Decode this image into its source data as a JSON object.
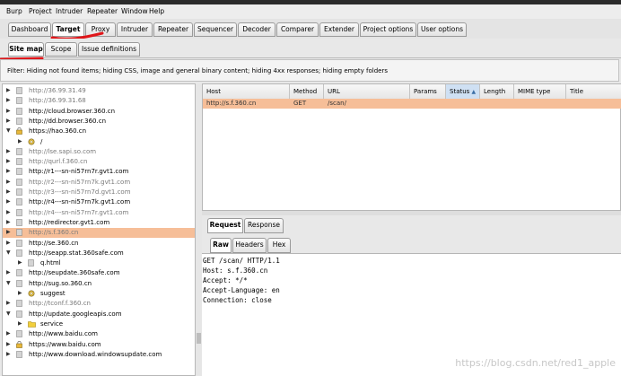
{
  "menu": [
    "Burp",
    "Project",
    "Intruder",
    "Repeater",
    "Window",
    "Help"
  ],
  "main_tabs": [
    "Dashboard",
    "Target",
    "Proxy",
    "Intruder",
    "Repeater",
    "Sequencer",
    "Decoder",
    "Comparer",
    "Extender",
    "Project options",
    "User options"
  ],
  "sub_tabs": [
    "Site map",
    "Scope",
    "Issue definitions"
  ],
  "filter_text": "Filter: Hiding not found items;  hiding CSS, image and general binary content;  hiding 4xx responses;  hiding empty folders",
  "tree": [
    {
      "label": "http://36.99.31.49",
      "bold": false,
      "expanded": false,
      "level": 0,
      "icon": "page-icon"
    },
    {
      "label": "http://36.99.31.68",
      "bold": false,
      "expanded": false,
      "level": 0,
      "icon": "page-icon"
    },
    {
      "label": "http://cloud.browser.360.cn",
      "bold": true,
      "expanded": false,
      "level": 0,
      "icon": "page-icon"
    },
    {
      "label": "http://dd.browser.360.cn",
      "bold": true,
      "expanded": false,
      "level": 0,
      "icon": "page-icon"
    },
    {
      "label": "https://hao.360.cn",
      "bold": true,
      "expanded": true,
      "level": 0,
      "icon": "lock-icon"
    },
    {
      "label": "/",
      "bold": true,
      "expanded": false,
      "level": 1,
      "icon": "gear-icon"
    },
    {
      "label": "http://lse.sapi.so.com",
      "bold": false,
      "expanded": false,
      "level": 0,
      "icon": "page-icon"
    },
    {
      "label": "http://qurl.f.360.cn",
      "bold": false,
      "expanded": false,
      "level": 0,
      "icon": "page-icon"
    },
    {
      "label": "http://r1---sn-ni57rn7r.gvt1.com",
      "bold": true,
      "expanded": false,
      "level": 0,
      "icon": "page-icon"
    },
    {
      "label": "http://r2---sn-ni57rn7k.gvt1.com",
      "bold": false,
      "expanded": false,
      "level": 0,
      "icon": "page-icon"
    },
    {
      "label": "http://r3---sn-ni57rn7d.gvt1.com",
      "bold": false,
      "expanded": false,
      "level": 0,
      "icon": "page-icon"
    },
    {
      "label": "http://r4---sn-ni57rn7k.gvt1.com",
      "bold": true,
      "expanded": false,
      "level": 0,
      "icon": "page-icon"
    },
    {
      "label": "http://r4---sn-ni57rn7r.gvt1.com",
      "bold": false,
      "expanded": false,
      "level": 0,
      "icon": "page-icon"
    },
    {
      "label": "http://redirector.gvt1.com",
      "bold": true,
      "expanded": false,
      "level": 0,
      "icon": "page-icon"
    },
    {
      "label": "http://s.f.360.cn",
      "bold": false,
      "expanded": false,
      "level": 0,
      "icon": "page-icon",
      "selected": true
    },
    {
      "label": "http://se.360.cn",
      "bold": true,
      "expanded": false,
      "level": 0,
      "icon": "page-icon"
    },
    {
      "label": "http://seapp.stat.360safe.com",
      "bold": true,
      "expanded": true,
      "level": 0,
      "icon": "page-icon"
    },
    {
      "label": "q.html",
      "bold": true,
      "expanded": false,
      "level": 1,
      "icon": "page-icon"
    },
    {
      "label": "http://seupdate.360safe.com",
      "bold": true,
      "expanded": false,
      "level": 0,
      "icon": "page-icon"
    },
    {
      "label": "http://sug.so.360.cn",
      "bold": true,
      "expanded": true,
      "level": 0,
      "icon": "page-icon"
    },
    {
      "label": "suggest",
      "bold": true,
      "expanded": false,
      "level": 1,
      "icon": "gear-icon"
    },
    {
      "label": "http://tconf.f.360.cn",
      "bold": false,
      "expanded": false,
      "level": 0,
      "icon": "page-icon"
    },
    {
      "label": "http://update.googleapis.com",
      "bold": true,
      "expanded": true,
      "level": 0,
      "icon": "page-icon"
    },
    {
      "label": "service",
      "bold": true,
      "expanded": false,
      "level": 1,
      "icon": "folder-icon"
    },
    {
      "label": "http://www.baidu.com",
      "bold": true,
      "expanded": false,
      "level": 0,
      "icon": "page-icon"
    },
    {
      "label": "https://www.baidu.com",
      "bold": true,
      "expanded": false,
      "level": 0,
      "icon": "lock-icon"
    },
    {
      "label": "http://www.download.windowsupdate.com",
      "bold": true,
      "expanded": false,
      "level": 0,
      "icon": "page-icon"
    }
  ],
  "table": {
    "columns": [
      "Host",
      "Method",
      "URL",
      "Params",
      "Status",
      "Length",
      "MIME type",
      "Title"
    ],
    "sorted_column": "Status",
    "sort_glyph": "▲",
    "rows": [
      {
        "host": "http://s.f.360.cn",
        "method": "GET",
        "url": "/scan/"
      }
    ]
  },
  "request_tabs": [
    "Request",
    "Response"
  ],
  "raw_tabs": [
    "Raw",
    "Headers",
    "Hex"
  ],
  "request_lines": [
    "GET /scan/ HTTP/1.1",
    "Host: s.f.360.cn",
    "Accept: */*",
    "Accept-Language: en",
    "Connection: close"
  ],
  "watermark": "https://blog.csdn.net/red1_apple",
  "colors": {
    "selection": "#f6be98",
    "annotation": "#e0161a"
  }
}
